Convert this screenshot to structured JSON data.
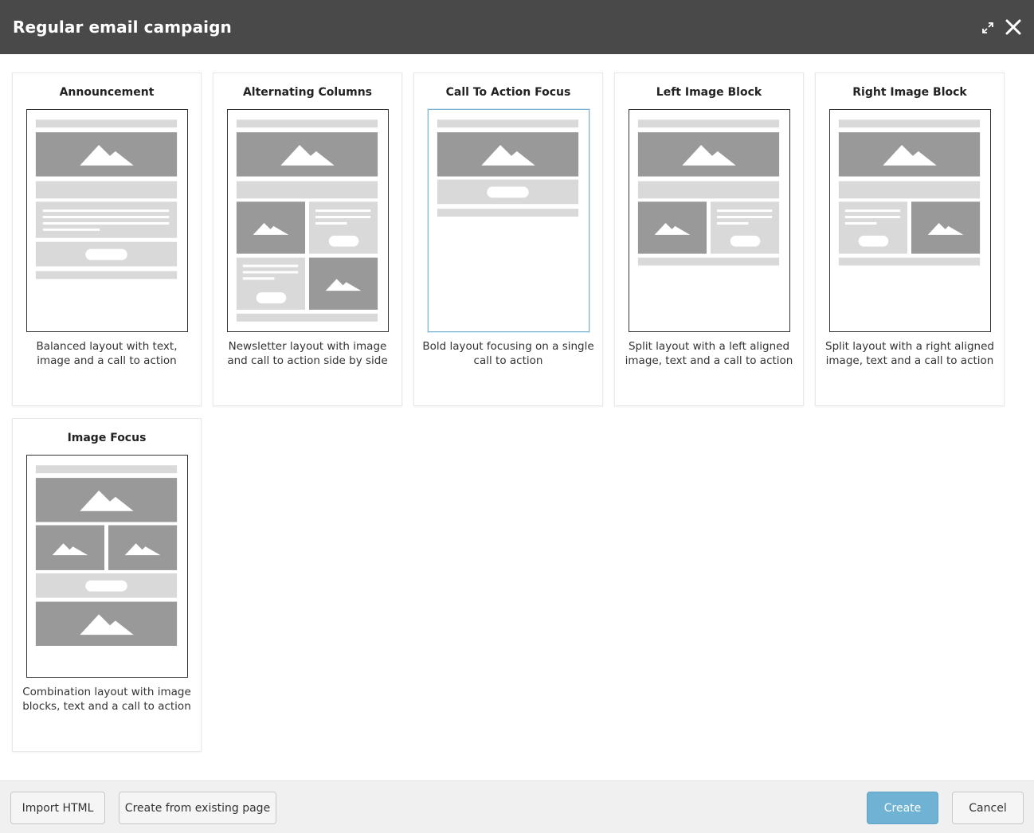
{
  "dialog": {
    "title": "Regular email campaign"
  },
  "templates": [
    {
      "title": "Announcement",
      "description_line1": "Balanced layout with text,",
      "description_line2": "image and a call to action"
    },
    {
      "title": "Alternating Columns",
      "description_line1": "Newsletter layout with image",
      "description_line2": "and call to action side by side"
    },
    {
      "title": "Call To Action Focus",
      "description_line1": "Bold layout focusing on a single",
      "description_line2": "call to action"
    },
    {
      "title": "Left Image Block",
      "description_line1": "Split layout with a left aligned",
      "description_line2": "image, text and a call to action"
    },
    {
      "title": "Right Image Block",
      "description_line1": "Split layout with a right aligned",
      "description_line2": "image, text and a call to action"
    },
    {
      "title": "Image Focus",
      "description_line1": "Combination layout with image",
      "description_line2": "blocks, text and a call to action"
    }
  ],
  "selected_template": "Call To Action Focus",
  "footer": {
    "import_html": "Import HTML",
    "create_from_existing": "Create from existing page",
    "create": "Create",
    "cancel": "Cancel"
  },
  "colors": {
    "header_bg": "#494949",
    "primary_button": "#6fb2d3",
    "placeholder_dark": "#999999",
    "placeholder_light": "#d9d9d9"
  }
}
